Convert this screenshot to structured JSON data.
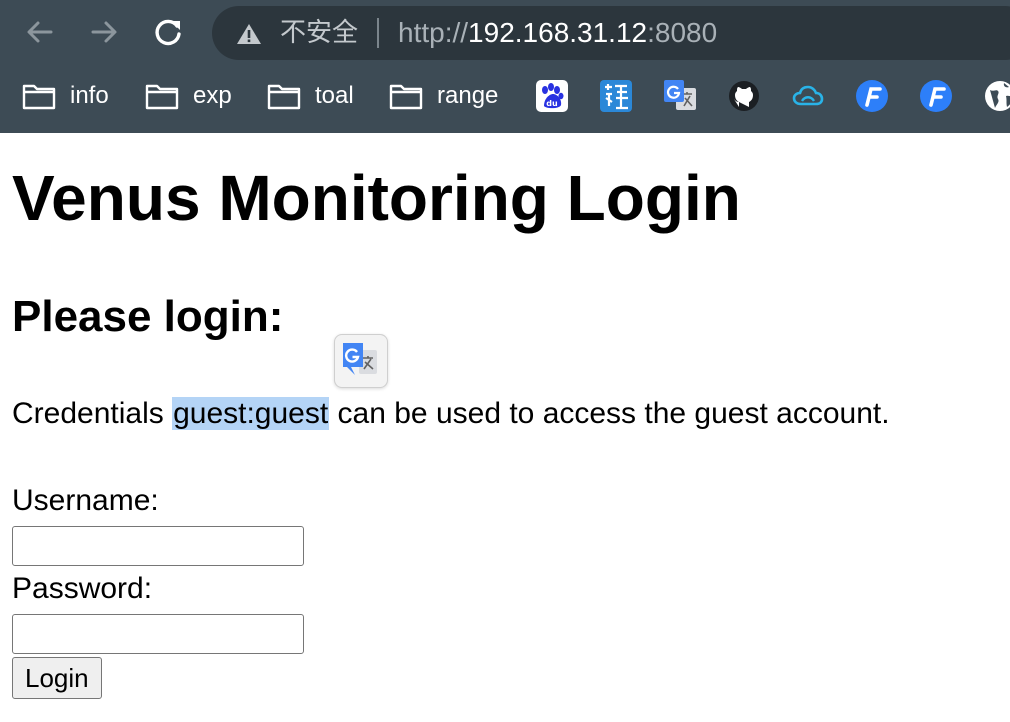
{
  "browser": {
    "security_label": "不安全",
    "url_scheme": "http://",
    "url_host": "192.168.31.12",
    "url_port": ":8080",
    "bookmarks": [
      {
        "label": "info"
      },
      {
        "label": "exp"
      },
      {
        "label": "toal"
      },
      {
        "label": "range"
      }
    ],
    "bookmark_icons": [
      "baidu-icon",
      "fanyi-icon",
      "google-translate-icon",
      "github-icon",
      "cloud-icon",
      "f-app-icon",
      "f-app-icon",
      "globe-icon"
    ]
  },
  "page": {
    "title": "Venus Monitoring Login",
    "subtitle": "Please login:",
    "credentials_before": "Credentials ",
    "credentials_highlight": "guest:guest",
    "credentials_after": " can be used to access the guest account.",
    "username_label": "Username:",
    "username_value": "",
    "password_label": "Password:",
    "password_value": "",
    "login_label": "Login"
  },
  "colors": {
    "chrome_bg": "#3d4b55",
    "omnibox_bg": "#2c363d",
    "highlight": "#b4d4f6",
    "link_blue": "#1a73e8"
  }
}
